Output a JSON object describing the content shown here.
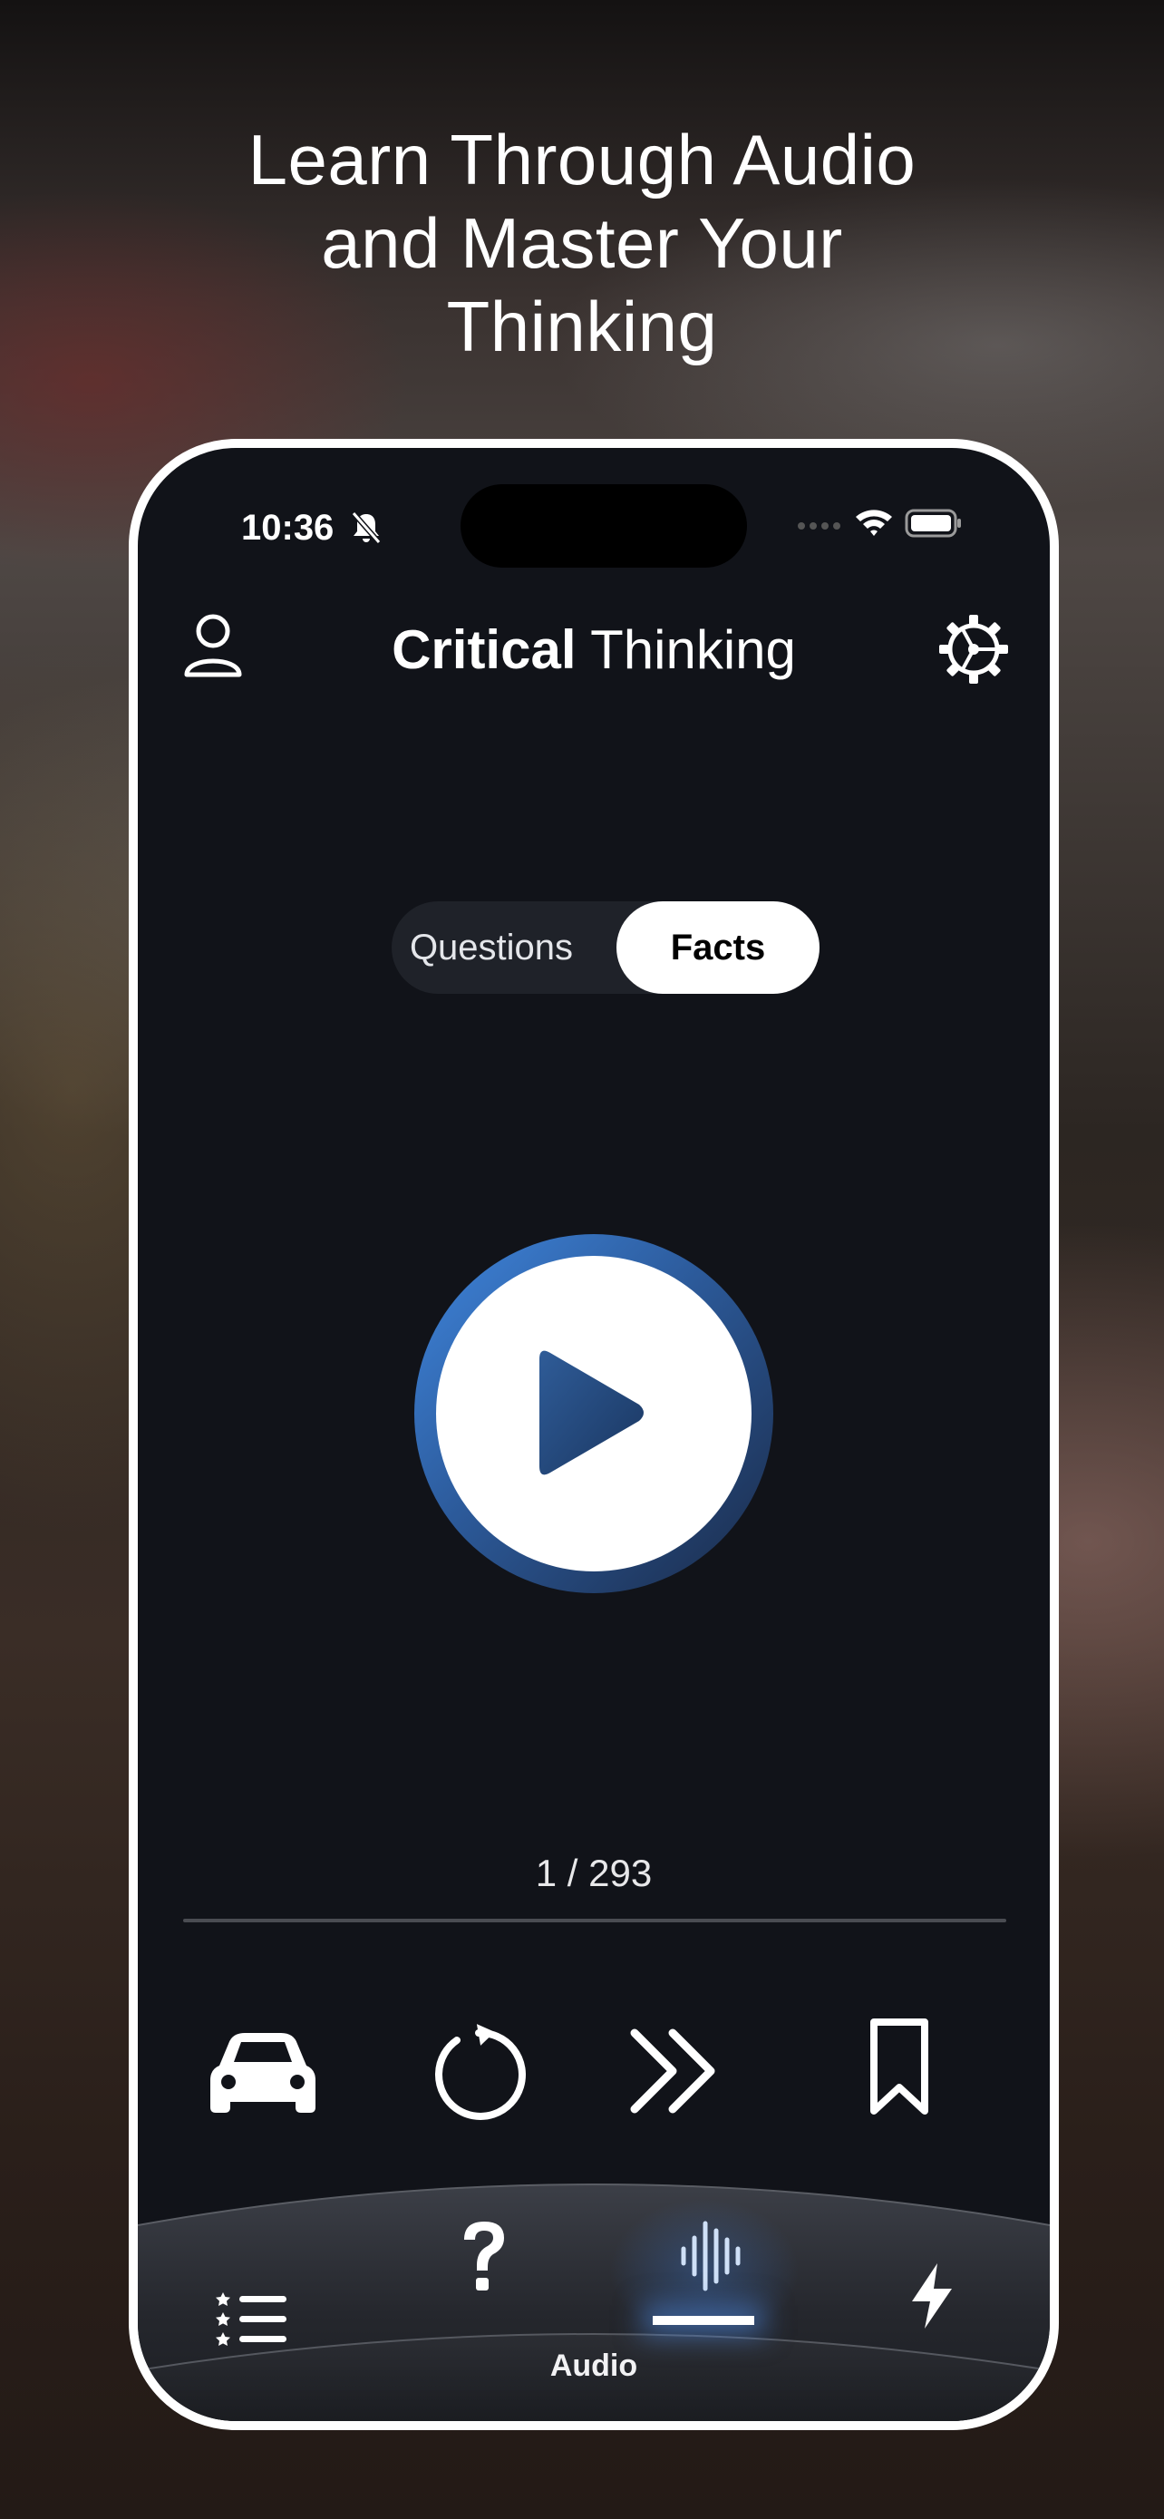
{
  "headline": "Learn Through Audio\nand Master Your\nThinking",
  "status_bar": {
    "time": "10:36"
  },
  "header": {
    "title_bold": "Critical",
    "title_regular": "Thinking"
  },
  "segment": {
    "option_1": "Questions",
    "option_2": "Facts",
    "selected": "Facts"
  },
  "player": {
    "counter": "1 / 293",
    "progress_fraction": 0.0
  },
  "controls": [
    "car-icon",
    "replay-icon",
    "skip-forward-icon",
    "bookmark-icon"
  ],
  "tab_bar": {
    "tabs": [
      "list-icon",
      "question-icon",
      "audio-waveform-icon",
      "bolt-icon"
    ],
    "active_label": "Audio"
  },
  "colors": {
    "accent_blue": "#3f86de",
    "dark_blue": "#1f3f6e",
    "screen_bg": "#111319"
  }
}
